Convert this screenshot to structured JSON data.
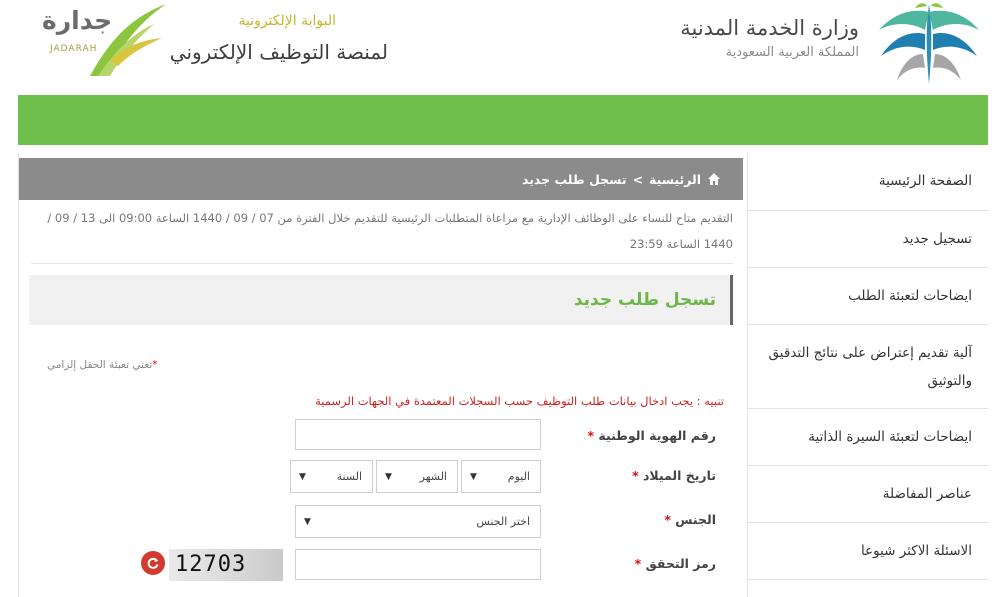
{
  "header": {
    "ministry_title": "وزارة الخدمة المدنية",
    "ministry_subtitle": "المملكة العربية السعودية",
    "logo_ar": "جدارة",
    "logo_en": "JADARAH",
    "portal_top": "البوابة الإلكترونية",
    "portal_main": "لمنصة التوظيف الإلكتروني"
  },
  "colors": {
    "green_bar": "#6fbf4d",
    "title_green": "#6fb64a",
    "warning_red": "#cf1f1f",
    "breadcrumb_bg": "#8b8b8b"
  },
  "sidebar": {
    "items": [
      {
        "label": "الصفحة الرئيسية"
      },
      {
        "label": "تسجيل جديد"
      },
      {
        "label": "ايضاحات لتعبئة الطلب"
      },
      {
        "label": "آلية تقديم إعتراض على نتائج التدقيق والتوثيق"
      },
      {
        "label": "ايضاحات لتعبئة السيرة الذاتية"
      },
      {
        "label": "عناصر المفاضلة"
      },
      {
        "label": "الاسئلة الاكثر شيوعا"
      }
    ]
  },
  "breadcrumb": {
    "home": "الرئيسية",
    "separator": ">",
    "current": "تسجل طلب جديد",
    "icon": "home-icon"
  },
  "notice": "التقديم متاح للنساء على الوظائف الإدارية مع مراعاة المتطلبات الرئيسية للتقديم خلال الفترة من 07 / 09 / 1440 الساعة 09:00 الى 13 / 09 / 1440 الساعة 23:59",
  "form": {
    "title": "تسجل طلب جديد",
    "required_star": "*",
    "required_hint": "تعني تعبئة الحقل إلزامي",
    "warning": "تنبيه : يجب ادخال بيانات طلب التوظيف حسب السجلات المعتمدة في الجهات الرسمية",
    "national_id": {
      "label": "رقم الهوية الوطنية",
      "value": ""
    },
    "birth_date": {
      "label": "تاريخ الميلاد",
      "day": "اليوم",
      "month": "الشهر",
      "year": "السنة"
    },
    "gender": {
      "label": "الجنس",
      "selected": "اختر الجنس"
    },
    "captcha": {
      "label": "رمز التحقق",
      "code": "12703",
      "value": "",
      "refresh_icon": "refresh-icon"
    }
  }
}
